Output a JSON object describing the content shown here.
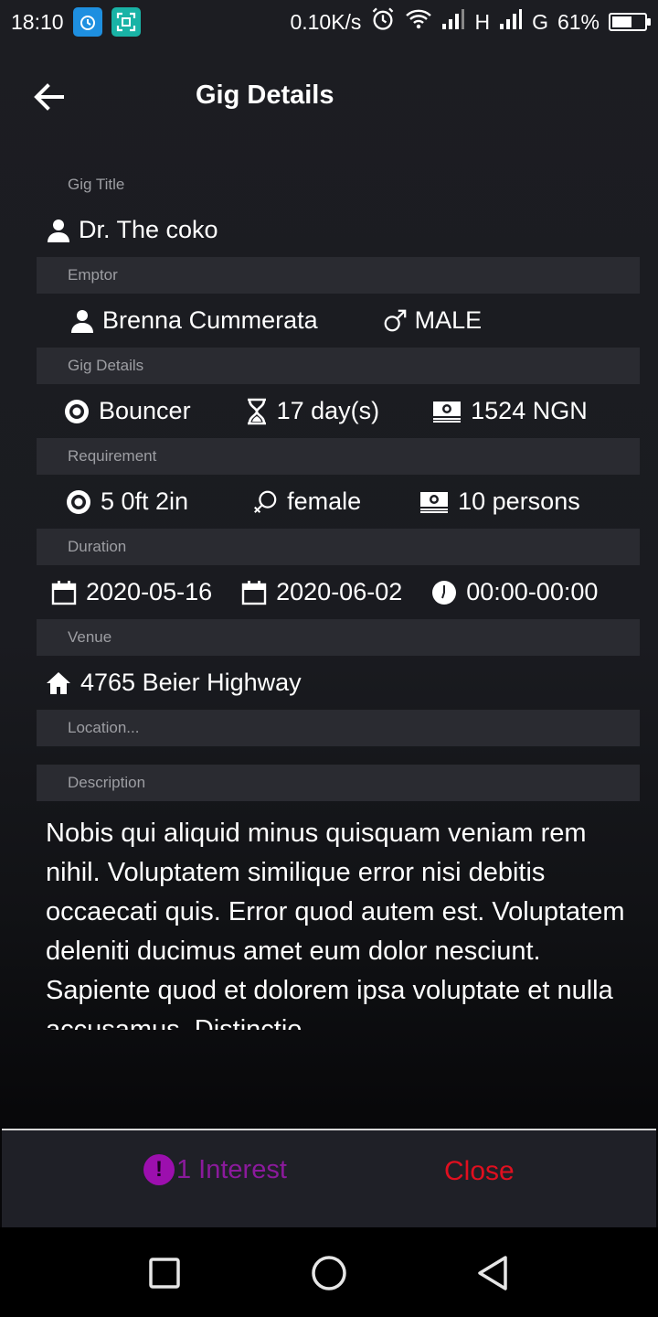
{
  "status_bar": {
    "time": "18:10",
    "speed": "0.10K/s",
    "network_h": "H",
    "network_g": "G",
    "battery": "61%",
    "battery_level": 0.61
  },
  "header": {
    "title": "Gig Details",
    "back_icon": "arrow-left-icon"
  },
  "gig": {
    "title_label": "Gig Title",
    "title_value": "Dr. The coko",
    "emptor_label": "Emptor",
    "emptor_name": "Brenna Cummerata",
    "emptor_gender": "MALE",
    "details_label": "Gig Details",
    "role": "Bouncer",
    "length": "17 day(s)",
    "pay": "1524 NGN",
    "requirement_label": "Requirement",
    "height": "5 0ft 2in",
    "gender_required": "female",
    "persons": "10 persons",
    "duration_label": "Duration",
    "start_date": "2020-05-16",
    "end_date": "2020-06-02",
    "time_range": "00:00-00:00",
    "venue_label": "Venue",
    "venue_address": "4765 Beier Highway",
    "location_placeholder": "Location...",
    "description_label": "Description",
    "description": "Nobis qui aliquid minus quisquam veniam rem nihil. Voluptatem similique error nisi debitis occaecati quis. Error quod autem est. Voluptatem deleniti ducimus amet eum dolor nesciunt. Sapiente quod et dolorem ipsa voluptate et nulla accusamus. Distinctio"
  },
  "actions": {
    "interest_badge": "!",
    "interest_label": "1 Interest",
    "close_label": "Close"
  },
  "colors": {
    "accent_purple": "#9c0fae",
    "close_red": "#e00f1f",
    "bar_gray": "#2a2b31"
  }
}
